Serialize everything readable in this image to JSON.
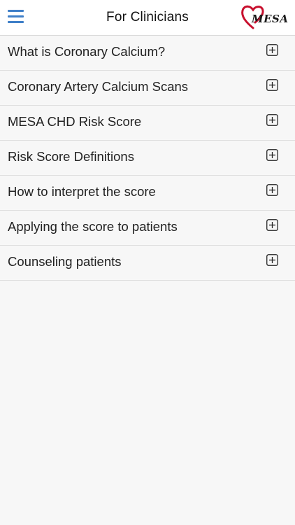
{
  "header": {
    "title": "For Clinicians",
    "menu_icon": "hamburger-menu-icon",
    "logo_text": "MESA",
    "accent_color": "#3f7fc8",
    "logo_color": "#c8102e"
  },
  "sections": [
    {
      "label": "What is Coronary Calcium?",
      "icon": "expand-plus-icon"
    },
    {
      "label": "Coronary Artery Calcium Scans",
      "icon": "expand-plus-icon"
    },
    {
      "label": "MESA CHD Risk Score",
      "icon": "expand-plus-icon"
    },
    {
      "label": "Risk Score Definitions",
      "icon": "expand-plus-icon"
    },
    {
      "label": "How to interpret the score",
      "icon": "expand-plus-icon"
    },
    {
      "label": "Applying the score to patients",
      "icon": "expand-plus-icon"
    },
    {
      "label": "Counseling patients",
      "icon": "expand-plus-icon"
    }
  ]
}
